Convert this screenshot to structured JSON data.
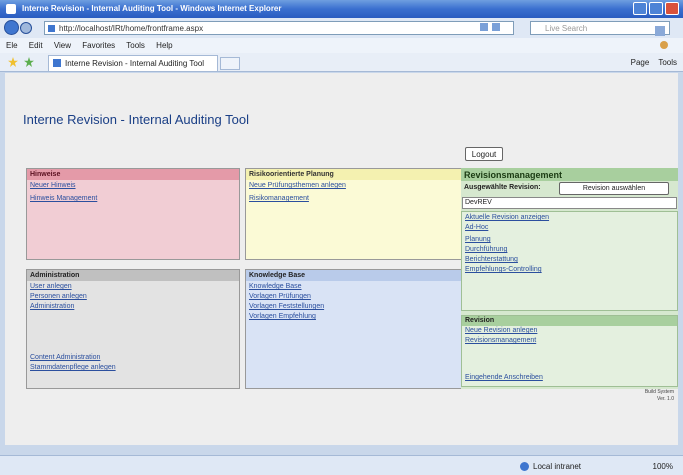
{
  "window": {
    "title": "Interne Revision - Internal Auditing Tool - Windows Internet Explorer"
  },
  "browser": {
    "url": "http://localhost/IRt/home/frontframe.aspx",
    "search_placeholder": "Live Search",
    "menus": [
      "Ele",
      "Edit",
      "View",
      "Favorites",
      "Tools",
      "Help"
    ],
    "tab_title": "Interne Revision - Internal Auditing Tool",
    "commands": [
      "Page",
      "Tools"
    ],
    "status_zone": "Local intranet",
    "zoom": "100%"
  },
  "page": {
    "title": "Interne Revision - Internal Auditing Tool",
    "logout_label": "Logout"
  },
  "hinweise": {
    "header": "Hinweise",
    "links": [
      "Neuer Hinweis",
      "Hinweis Management"
    ]
  },
  "planung": {
    "header": "Risikoorientierte Planung",
    "links": [
      "Neue Prüfungsthemen anlegen",
      "Risikomanagement"
    ]
  },
  "administration": {
    "header": "Administration",
    "links": [
      "User anlegen",
      "Personen anlegen",
      "Administration"
    ],
    "bottom_links": [
      "Content Administration",
      "Stammdatenpflege anlegen"
    ]
  },
  "knowledge": {
    "header": "Knowledge Base",
    "links": [
      "Knowledge Base",
      "Vorlagen Prüfungen",
      "Vorlagen Feststellungen",
      "Vorlagen Empfehlung"
    ]
  },
  "revisionsmanagement": {
    "header": "Revisionsmanagement",
    "selected_label": "Ausgewählte Revision:",
    "select_button": "Revision auswählen",
    "selected_value": "DevREV",
    "links": [
      "Aktuelle Revision anzeigen",
      "Ad-Hoc",
      "Planung",
      "Durchführung",
      "Berichterstattung",
      "Empfehlungs-Controlling"
    ],
    "revision_header": "Revision",
    "revision_links": [
      "Neue Revision anlegen",
      "Revisionsmanagement"
    ],
    "revision_bottom_link": "Eingehende Anschreiben"
  },
  "footer": {
    "version_line1": "Build System",
    "version_line2": "Ver. 1.0"
  }
}
